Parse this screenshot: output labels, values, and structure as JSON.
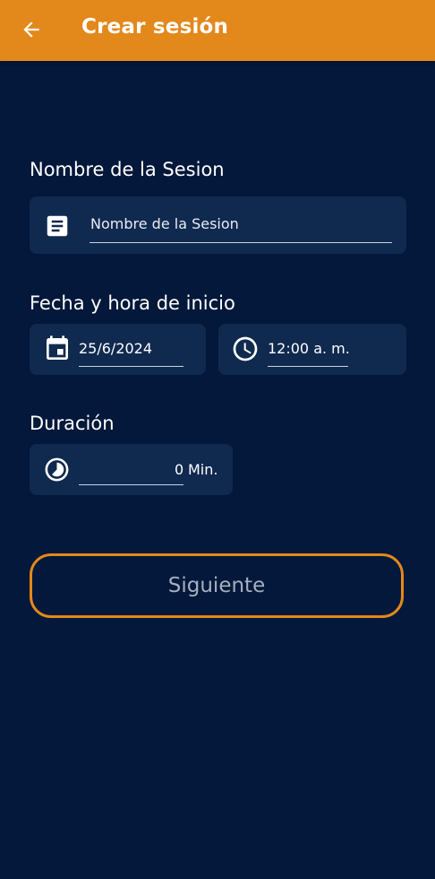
{
  "header": {
    "title": "Crear sesión",
    "back_icon": "arrow-left-icon",
    "background": "#e3881b"
  },
  "form": {
    "session_name": {
      "label": "Nombre de la Sesion",
      "placeholder": "Nombre de la Sesion",
      "icon": "notes-icon"
    },
    "start": {
      "label": "Fecha y hora de inicio",
      "date_value": "25/6/2024",
      "date_icon": "calendar-icon",
      "time_value": "12:00 a. m.",
      "time_icon": "clock-icon"
    },
    "duration": {
      "label": "Duración",
      "value": "0",
      "unit": "Min.",
      "icon": "timelapse-icon"
    }
  },
  "actions": {
    "next_label": "Siguiente",
    "accent": "#e3881b"
  },
  "colors": {
    "background": "#03183a",
    "card": "#10294f"
  }
}
